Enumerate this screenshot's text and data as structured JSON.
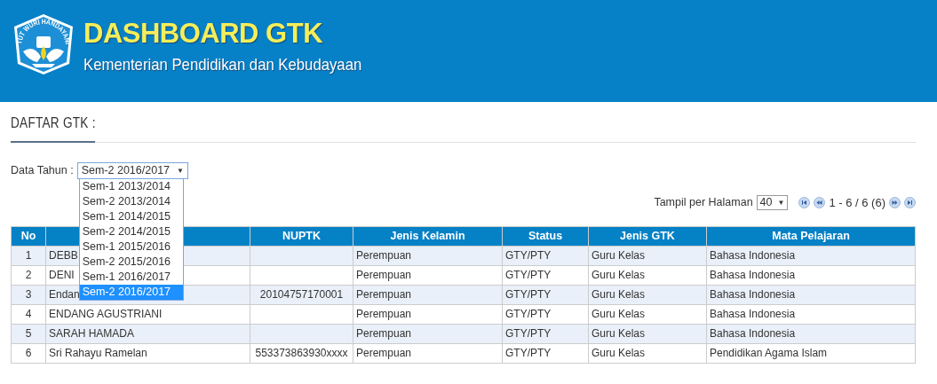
{
  "header": {
    "logo_motto": "TUT WURI HANDAYANI",
    "title": "DASHBOARD GTK",
    "subtitle": "Kementerian Pendidikan dan Kebudayaan"
  },
  "section": {
    "title": "DAFTAR GTK :"
  },
  "year_filter": {
    "label": "Data Tahun :",
    "value": "Sem-2 2016/2017",
    "arrow": "▼",
    "expanded": true,
    "options": [
      {
        "label": "Sem-1 2013/2014",
        "selected": false
      },
      {
        "label": "Sem-2 2013/2014",
        "selected": false
      },
      {
        "label": "Sem-1 2014/2015",
        "selected": false
      },
      {
        "label": "Sem-2 2014/2015",
        "selected": false
      },
      {
        "label": "Sem-1 2015/2016",
        "selected": false
      },
      {
        "label": "Sem-2 2015/2016",
        "selected": false
      },
      {
        "label": "Sem-1 2016/2017",
        "selected": false
      },
      {
        "label": "Sem-2 2016/2017",
        "selected": true
      }
    ]
  },
  "pager": {
    "label": "Tampil per Halaman",
    "per_page": "40",
    "arrow": "▼",
    "range": "1 - 6 / 6 (6)"
  },
  "table": {
    "columns": [
      "No",
      "",
      "NUPTK",
      "Jenis Kelamin",
      "Status",
      "Jenis GTK",
      "Mata Pelajaran"
    ],
    "rows": [
      [
        "1",
        "DEBB",
        "",
        "Perempuan",
        "GTY/PTY",
        "Guru Kelas",
        "Bahasa Indonesia"
      ],
      [
        "2",
        "DENI",
        "",
        "Perempuan",
        "GTY/PTY",
        "Guru Kelas",
        "Bahasa Indonesia"
      ],
      [
        "3",
        "Endan",
        "20104757170001",
        "Perempuan",
        "GTY/PTY",
        "Guru Kelas",
        "Bahasa Indonesia"
      ],
      [
        "4",
        "ENDANG AGUSTRIANI",
        "",
        "Perempuan",
        "GTY/PTY",
        "Guru Kelas",
        "Bahasa Indonesia"
      ],
      [
        "5",
        "SARAH HAMADA",
        "",
        "Perempuan",
        "GTY/PTY",
        "Guru Kelas",
        "Bahasa Indonesia"
      ],
      [
        "6",
        "Sri Rahayu Ramelan",
        "553373863930xxxx",
        "Perempuan",
        "GTY/PTY",
        "Guru Kelas",
        "Pendidikan Agama Islam"
      ]
    ]
  }
}
